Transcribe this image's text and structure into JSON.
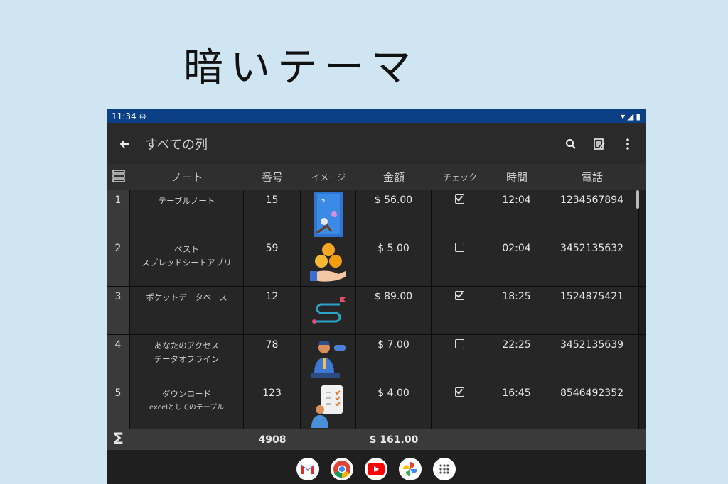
{
  "headline": "暗いテーマ",
  "status": {
    "time": "11:34"
  },
  "appbar": {
    "title": "すべての列"
  },
  "columns": [
    "ノート",
    "番号",
    "イメージ",
    "金額",
    "チェック",
    "時間",
    "電話"
  ],
  "rows": [
    {
      "num": "1",
      "note": [
        "テーブルノート"
      ],
      "number": "15",
      "image": "card-game-image",
      "amount": "$ 56.00",
      "checked": true,
      "time": "12:04",
      "phone": "1234567894"
    },
    {
      "num": "2",
      "note": [
        "ベスト",
        "スプレッドシートアプリ"
      ],
      "number": "59",
      "image": "coins-hand-image",
      "amount": "$ 5.00",
      "checked": false,
      "time": "02:04",
      "phone": "3452135632"
    },
    {
      "num": "3",
      "note": [
        "ポケットデータベース"
      ],
      "number": "12",
      "image": "route-path-image",
      "amount": "$ 89.00",
      "checked": true,
      "time": "18:25",
      "phone": "1524875421"
    },
    {
      "num": "4",
      "note": [
        "あなたのアクセス",
        "データオフライン"
      ],
      "number": "78",
      "image": "businessman-image",
      "amount": "$ 7.00",
      "checked": false,
      "time": "22:25",
      "phone": "3452135639"
    },
    {
      "num": "5",
      "note": [
        "ダウンロード",
        "excelとしてのテーブル"
      ],
      "number": "123",
      "image": "checklist-person-image",
      "amount": "$ 4.00",
      "checked": true,
      "time": "16:45",
      "phone": "8546492352"
    }
  ],
  "totals": {
    "symbol": "Σ",
    "number": "4908",
    "amount": "$ 161.00"
  },
  "dock": [
    "gmail-icon",
    "chrome-icon",
    "youtube-icon",
    "photos-icon",
    "apps-icon"
  ]
}
